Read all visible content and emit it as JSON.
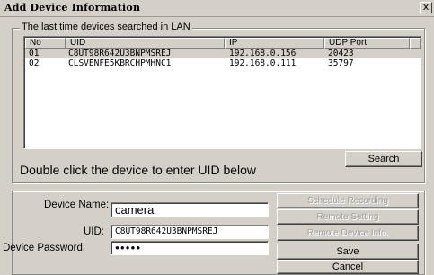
{
  "window": {
    "title": "Add Device Information",
    "close_glyph": "x"
  },
  "lan_group": {
    "legend": "The last time devices searched in LAN",
    "columns": [
      "No",
      "UID",
      "IP",
      "UDP Port"
    ],
    "rows": [
      {
        "no": "01",
        "uid": "C8UT98R642U3BNPMSREJ",
        "ip": "192.168.0.156",
        "port": "20423",
        "selected": true
      },
      {
        "no": "02",
        "uid": "CLSVENFE5KBRCHPMHNC1",
        "ip": "192.168.0.111",
        "port": "35797",
        "selected": false
      }
    ],
    "search_label": "Search",
    "hint": "Double click the device to enter UID below"
  },
  "device_form": {
    "device_name_label": "Device Name:",
    "device_name_value": "camera",
    "uid_label": "UID:",
    "uid_value": "C8UT98R642U3BNPMSREJ",
    "password_label": "Device Password:",
    "password_value": "●●●●●",
    "schedule_label": "Schedule Recording",
    "remote_setting_label": "Remote Setting",
    "remote_info_label": "Remote Device Info.",
    "save_label": "Save",
    "cancel_label": "Cancel"
  }
}
